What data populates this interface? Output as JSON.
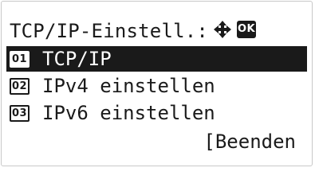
{
  "header": {
    "title": "TCP/IP-Einstell.:",
    "nav_icon": "four-way-arrow-icon",
    "ok_label": "OK"
  },
  "menu": {
    "items": [
      {
        "number": "01",
        "label": "TCP/IP",
        "selected": true
      },
      {
        "number": "02",
        "label": "IPv4 einstellen",
        "selected": false
      },
      {
        "number": "03",
        "label": "IPv6 einstellen",
        "selected": false
      }
    ]
  },
  "footer": {
    "exit_label": "[Beenden"
  },
  "colors": {
    "foreground": "#1a1a1a",
    "background": "#ffffff",
    "highlight": "#1a1a1a"
  }
}
